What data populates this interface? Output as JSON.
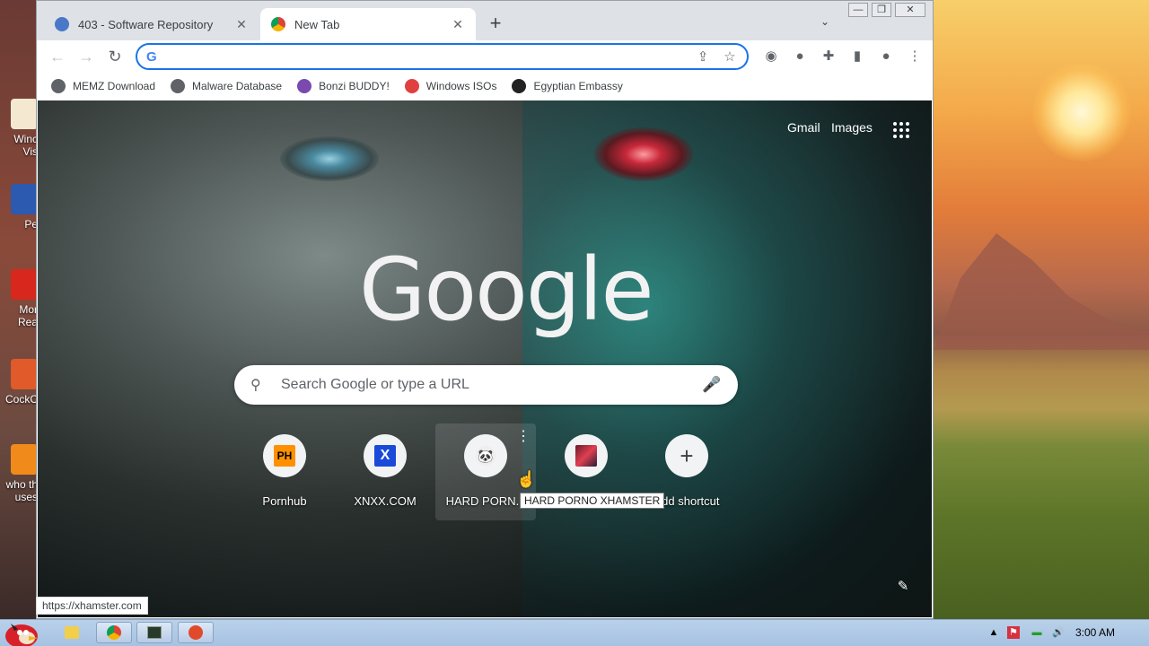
{
  "desktop": {
    "icons": [
      {
        "label": "Winc Vis",
        "color": "#f4e8d0"
      },
      {
        "label": "Pe",
        "color": "#2b5ab0"
      },
      {
        "label": "Mor Rea",
        "color": "#d8281e"
      },
      {
        "label": "CockC",
        "color": "#e05a2a"
      },
      {
        "label": "who th uses",
        "color": "#f08a1a"
      }
    ]
  },
  "browser": {
    "tabs": [
      {
        "title": "403 - Software Repository",
        "icon": "globe-icon",
        "active": false
      },
      {
        "title": "New Tab",
        "icon": "chrome-icon",
        "active": true
      }
    ],
    "new_tab_symbol": "+",
    "tab_search_symbol": "⌄",
    "window_controls": {
      "minimize": "—",
      "restore": "❐",
      "close": "✕"
    },
    "toolbar": {
      "back": "←",
      "forward": "→",
      "reload": "↻",
      "omnibox_value": "",
      "omnibox_placeholder": "",
      "google_g": "G",
      "share_icon": "⇪",
      "star_icon": "☆"
    },
    "extensions": [
      {
        "name": "ublock-icon",
        "symbol": "◉"
      },
      {
        "name": "flag-extension-icon",
        "symbol": "●"
      },
      {
        "name": "extensions-puzzle-icon",
        "symbol": "✚"
      },
      {
        "name": "side-panel-icon",
        "symbol": "▮"
      },
      {
        "name": "profile-icon",
        "symbol": "●"
      },
      {
        "name": "menu-kebab-icon",
        "symbol": "⋮"
      }
    ],
    "bookmarks": [
      {
        "label": "MEMZ Download",
        "icon": "globe-icon",
        "color": "#5f6368"
      },
      {
        "label": "Malware Database",
        "icon": "globe-icon",
        "color": "#5f6368"
      },
      {
        "label": "Bonzi BUDDY!",
        "icon": "bonzi-icon",
        "color": "#7a4ab0"
      },
      {
        "label": "Windows ISOs",
        "icon": "rainbow-flag-icon",
        "color": "#e04040"
      },
      {
        "label": "Egyptian Embassy",
        "icon": "wix-icon",
        "color": "#222222"
      }
    ]
  },
  "ntp": {
    "gmail": "Gmail",
    "images": "Images",
    "logo": "Google",
    "search_placeholder": "Search Google or type a URL",
    "search_icon": "⚲",
    "mic_icon": "🎤",
    "shortcuts": [
      {
        "label": "Pornhub",
        "badge": "PH"
      },
      {
        "label": "XNXX.COM",
        "badge": "X"
      },
      {
        "label": "HARD PORN...",
        "badge": "🐼"
      },
      {
        "label": "",
        "badge": ""
      },
      {
        "label": "Add shortcut",
        "badge": "+"
      }
    ],
    "kebab": "⋮",
    "tooltip": "HARD PORNO XHAMSTER",
    "customize_icon": "✎"
  },
  "statusbar": {
    "url": "https://xhamster.com"
  },
  "taskbar": {
    "clock": "3:00 AM",
    "tray": [
      "▲",
      "⚑",
      "▬",
      "🔊"
    ]
  }
}
